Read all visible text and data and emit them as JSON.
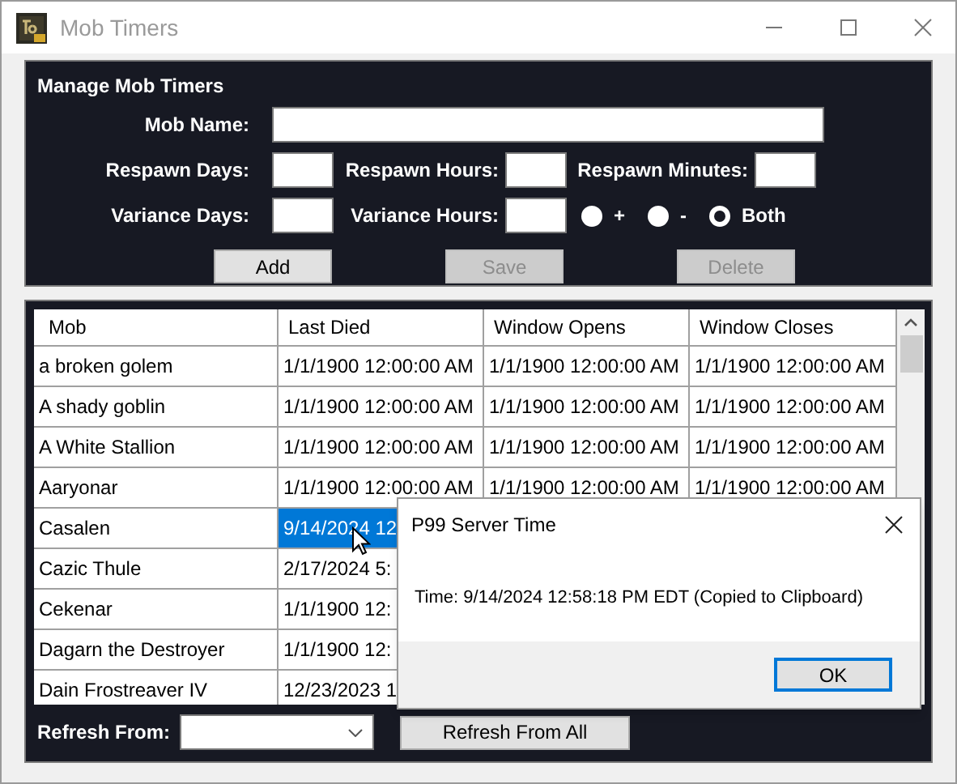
{
  "window": {
    "title": "Mob Timers"
  },
  "manage": {
    "title": "Manage Mob Timers",
    "mob_name": {
      "label": "Mob Name:"
    },
    "respawn_days": {
      "label": "Respawn Days:"
    },
    "respawn_hours": {
      "label": "Respawn Hours:"
    },
    "respawn_minutes": {
      "label": "Respawn Minutes:"
    },
    "variance_days": {
      "label": "Variance Days:"
    },
    "variance_hours": {
      "label": "Variance Hours:"
    },
    "variance_mode": [
      {
        "label": "+",
        "selected": false
      },
      {
        "label": "-",
        "selected": false
      },
      {
        "label": "Both",
        "selected": true
      }
    ],
    "buttons": [
      {
        "label": "Add",
        "disabled": false
      },
      {
        "label": "Save",
        "disabled": true
      },
      {
        "label": "Delete",
        "disabled": true
      }
    ]
  },
  "table": {
    "columns": [
      "Mob",
      "Last Died",
      "Window Opens",
      "Window Closes"
    ],
    "rows": [
      {
        "cells": [
          "a broken golem",
          "1/1/1900 12:00:00 AM",
          "1/1/1900 12:00:00 AM",
          "1/1/1900 12:00:00 AM"
        ],
        "selected": false
      },
      {
        "cells": [
          "A shady goblin",
          "1/1/1900 12:00:00 AM",
          "1/1/1900 12:00:00 AM",
          "1/1/1900 12:00:00 AM"
        ],
        "selected": false
      },
      {
        "cells": [
          "A White Stallion",
          "1/1/1900 12:00:00 AM",
          "1/1/1900 12:00:00 AM",
          "1/1/1900 12:00:00 AM"
        ],
        "selected": false
      },
      {
        "cells": [
          "Aaryonar",
          "1/1/1900 12:00:00 AM",
          "1/1/1900 12:00:00 AM",
          "1/1/1900 12:00:00 AM"
        ],
        "selected": false
      },
      {
        "cells": [
          "Casalen",
          "9/14/2024 12"
        ],
        "selected": true
      },
      {
        "cells": [
          "Cazic Thule",
          "2/17/2024 5:"
        ],
        "selected": false
      },
      {
        "cells": [
          "Cekenar",
          "1/1/1900 12:"
        ],
        "selected": false
      },
      {
        "cells": [
          "Dagarn the Destroyer",
          "1/1/1900 12:"
        ],
        "selected": false
      },
      {
        "cells": [
          "Dain Frostreaver IV",
          "12/23/2023 1"
        ],
        "selected": false
      }
    ]
  },
  "refresh": {
    "label": "Refresh From:",
    "button": "Refresh From All"
  },
  "dialog": {
    "title": "P99 Server Time",
    "message": "Time: 9/14/2024 12:58:18 PM EDT (Copied to Clipboard)",
    "button": "OK"
  }
}
